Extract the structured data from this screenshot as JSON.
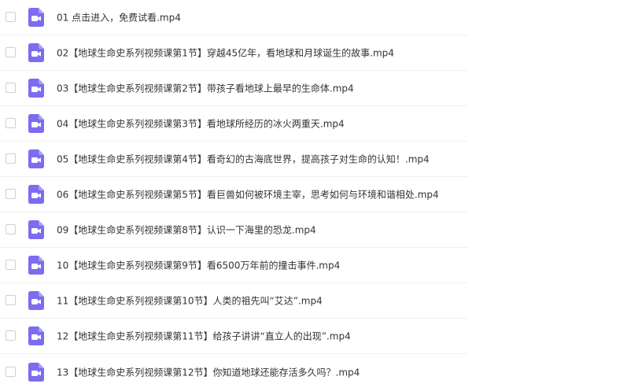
{
  "colors": {
    "icon_bg": "#7c6cf0",
    "icon_glyph": "#ffffff",
    "text": "#333333",
    "divider": "#f0f0f0"
  },
  "files": [
    {
      "name": "01 点击进入，免费试看.mp4",
      "icon": "video-file-icon"
    },
    {
      "name": "02【地球生命史系列视频课第1节】穿越45亿年，看地球和月球诞生的故事.mp4",
      "icon": "video-file-icon"
    },
    {
      "name": "03【地球生命史系列视频课第2节】带孩子看地球上最早的生命体.mp4",
      "icon": "video-file-icon"
    },
    {
      "name": "04【地球生命史系列视频课第3节】看地球所经历的冰火两重天.mp4",
      "icon": "video-file-icon"
    },
    {
      "name": "05【地球生命史系列视频课第4节】看奇幻的古海底世界，提高孩子对生命的认知！.mp4",
      "icon": "video-file-icon"
    },
    {
      "name": "06【地球生命史系列视频课第5节】看巨兽如何被环境主宰，思考如何与环境和谐相处.mp4",
      "icon": "video-file-icon"
    },
    {
      "name": "09【地球生命史系列视频课第8节】认识一下海里的恐龙.mp4",
      "icon": "video-file-icon"
    },
    {
      "name": "10【地球生命史系列视频课第9节】看6500万年前的撞击事件.mp4",
      "icon": "video-file-icon"
    },
    {
      "name": "11【地球生命史系列视频课第10节】人类的祖先叫“艾达”.mp4",
      "icon": "video-file-icon"
    },
    {
      "name": "12【地球生命史系列视频课第11节】给孩子讲讲“直立人的出现”.mp4",
      "icon": "video-file-icon"
    },
    {
      "name": "13【地球生命史系列视频课第12节】你知道地球还能存活多久吗？.mp4",
      "icon": "video-file-icon"
    }
  ]
}
